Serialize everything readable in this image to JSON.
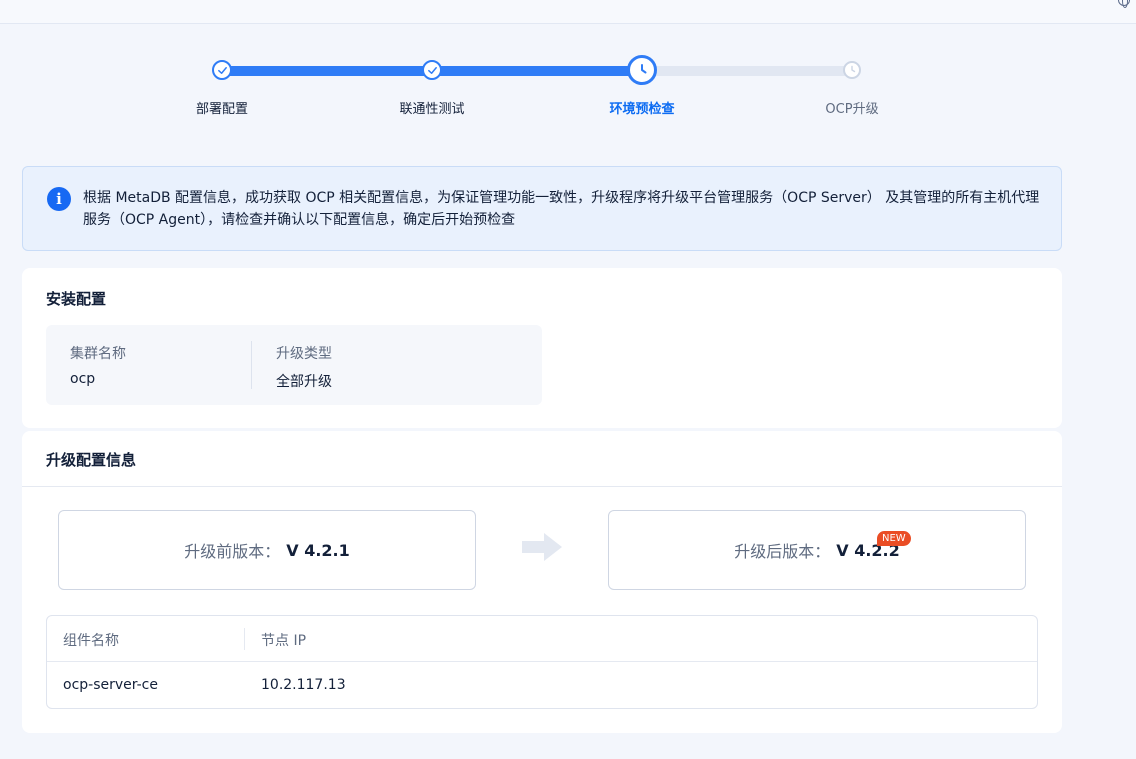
{
  "steps": [
    {
      "label": "部署配置",
      "status": "done"
    },
    {
      "label": "联通性测试",
      "status": "done"
    },
    {
      "label": "环境预检查",
      "status": "current"
    },
    {
      "label": "OCP升级",
      "status": "pending"
    }
  ],
  "alert": {
    "icon": "info-icon",
    "text": "根据 MetaDB 配置信息，成功获取 OCP 相关配置信息，为保证管理功能一致性，升级程序将升级平台管理服务（OCP Server） 及其管理的所有主机代理服务（OCP Agent），请检查并确认以下配置信息，确定后开始预检查"
  },
  "install_config": {
    "title": "安装配置",
    "fields": [
      {
        "label": "集群名称",
        "value": "ocp"
      },
      {
        "label": "升级类型",
        "value": "全部升级"
      }
    ]
  },
  "upgrade_info": {
    "title": "升级配置信息",
    "before_label": "升级前版本：",
    "before_version": "V 4.2.1",
    "after_label": "升级后版本：",
    "after_version": "V 4.2.2",
    "new_badge": "NEW",
    "table": {
      "columns": [
        "组件名称",
        "节点 IP"
      ],
      "rows": [
        [
          "ocp-server-ce",
          "10.2.117.13"
        ]
      ]
    }
  },
  "colors": {
    "primary": "#2f7cf6",
    "badge": "#ea4d25",
    "alert_bg": "#e9f1fd"
  }
}
